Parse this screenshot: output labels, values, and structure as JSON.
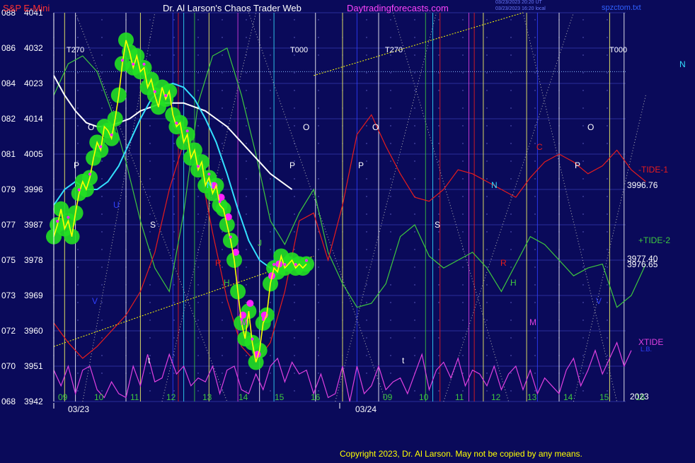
{
  "header": {
    "instrument": "S&P E-Mini",
    "site_title": "Dr. Al Larson's Chaos Trader Web",
    "site_url": "Daytradingforecasts.com",
    "timestamp_1": "03/23/2023 20:20 UT",
    "timestamp_2": "03/23/2023 16:20 local",
    "file_name": "spzctom.txt",
    "copyright": "Copyright 2023, Dr. Al Larson. May not be copied by any means."
  },
  "colors": {
    "background": "#0a0a5a",
    "grid": "#2b2f9a",
    "price_yellow": "#ffff00",
    "ema_white": "#ffffff",
    "ema_cyan": "#33e0ff",
    "tide_red": "#e81c1c",
    "tide_green": "#3ec83e",
    "xtide_magenta": "#e040e0",
    "bubble_green": "#22e022",
    "dot_magenta": "#ff22ff",
    "blue_line": "#3040ff"
  },
  "chart_data": {
    "type": "line",
    "y_axis_left_codes": [
      "088",
      "086",
      "084",
      "082",
      "081",
      "079",
      "077",
      "075",
      "073",
      "072",
      "070",
      "068"
    ],
    "y_axis_prices": [
      4041,
      4032,
      4023,
      4014,
      4005,
      3996,
      3987,
      3978,
      3969,
      3960,
      3951,
      3942
    ],
    "ylim": [
      3942,
      4041
    ],
    "x_hour_labels": [
      "09",
      "10",
      "11",
      "12",
      "13",
      "14",
      "15",
      "16",
      "09",
      "10",
      "11",
      "12",
      "13",
      "14",
      "15",
      "16"
    ],
    "x_date_labels": [
      "03/23",
      "03/24"
    ],
    "year_label": "2023",
    "series_labels": [
      "-TIDE-1",
      "+TIDE-2",
      "XTIDE",
      "L.B."
    ],
    "right_value_labels": [
      "3996.76",
      "3977.40",
      "3976.65"
    ],
    "marker_N": "N",
    "phase_labels": [
      "T270",
      "T000",
      "T270",
      "T000"
    ],
    "planet_letters": [
      "O",
      "P",
      "U",
      "V",
      "S",
      "N",
      "R",
      "H",
      "M",
      "J",
      "O",
      "P",
      "O",
      "P",
      "N",
      "S",
      "R",
      "H",
      "M",
      "O",
      "P",
      "C",
      "V",
      "t",
      "t"
    ],
    "price_series": {
      "name": "S&P E-Mini",
      "hours": [
        9.0,
        9.1,
        9.2,
        9.3,
        9.4,
        9.5,
        9.6,
        9.7,
        9.8,
        9.9,
        10.0,
        10.1,
        10.2,
        10.3,
        10.4,
        10.5,
        10.6,
        10.7,
        10.8,
        10.9,
        11.0,
        11.1,
        11.2,
        11.3,
        11.4,
        11.5,
        11.6,
        11.7,
        11.8,
        11.9,
        12.0,
        12.1,
        12.2,
        12.3,
        12.4,
        12.5,
        12.6,
        12.7,
        12.8,
        12.9,
        13.0,
        13.1,
        13.2,
        13.3,
        13.4,
        13.5,
        13.6,
        13.7,
        13.8,
        13.9,
        14.0,
        14.1,
        14.2,
        14.3,
        14.4,
        14.5,
        14.6,
        14.7,
        14.8,
        14.9,
        15.0,
        15.1,
        15.2,
        15.3,
        15.4,
        15.5,
        15.6,
        15.7,
        15.8,
        15.9,
        16.0
      ],
      "values": [
        3984,
        3987,
        3991,
        3986,
        3988,
        3984,
        3990,
        3995,
        3998,
        3996,
        3999,
        4004,
        4008,
        4006,
        4012,
        4011,
        4009,
        4014,
        4020,
        4028,
        4034,
        4031,
        4027,
        4030,
        4026,
        4027,
        4022,
        4024,
        4020,
        4017,
        4022,
        4019,
        4021,
        4015,
        4012,
        4013,
        4008,
        4010,
        4004,
        4006,
        4001,
        4003,
        3997,
        3999,
        3995,
        3997,
        3992,
        3991,
        3987,
        3983,
        3978,
        3970,
        3962,
        3958,
        3965,
        3957,
        3952,
        3955,
        3962,
        3964,
        3972,
        3976,
        3975,
        3979,
        3976,
        3977,
        3978,
        3976,
        3977,
        3976,
        3977
      ]
    },
    "ema_white": {
      "hours": [
        9.0,
        9.3,
        9.6,
        9.9,
        10.2,
        10.5,
        10.8,
        11.1,
        11.4,
        11.7,
        12.0,
        12.3,
        12.6,
        12.9,
        13.2,
        13.5,
        13.8,
        14.1,
        14.4,
        14.7,
        15.0,
        15.3,
        15.6
      ],
      "values": [
        4025,
        4020,
        4016,
        4013,
        4012,
        4012,
        4013,
        4014,
        4016,
        4017,
        4018,
        4018,
        4018,
        4017,
        4016,
        4014,
        4012,
        4009,
        4006,
        4003,
        4000,
        3998,
        3996
      ]
    },
    "ema_cyan": {
      "hours": [
        9.0,
        9.3,
        9.6,
        9.9,
        10.2,
        10.5,
        10.8,
        11.1,
        11.4,
        11.7,
        12.0,
        12.3,
        12.6,
        12.9,
        13.2,
        13.5,
        13.8,
        14.1,
        14.4,
        14.7,
        15.0,
        15.3,
        15.6,
        15.9
      ],
      "values": [
        3992,
        3996,
        3998,
        3996,
        3996,
        3998,
        4002,
        4008,
        4014,
        4019,
        4022,
        4023,
        4022,
        4019,
        4014,
        4008,
        4000,
        3991,
        3983,
        3978,
        3976,
        3975,
        3976,
        3977
      ]
    },
    "tide_red": {
      "hours": [
        9.0,
        9.4,
        9.8,
        10.2,
        10.6,
        11.0,
        11.4,
        11.8,
        12.2,
        12.6,
        13.0,
        13.4,
        13.8,
        14.2,
        14.6,
        15.0,
        15.4,
        15.8,
        16.2,
        16.6,
        17.0,
        17.4,
        17.8,
        18.2,
        18.6,
        19.0,
        19.4,
        19.8,
        20.2,
        20.6,
        21.0,
        21.4,
        21.8,
        22.2,
        22.6,
        23.0,
        23.4,
        23.8,
        24.2,
        24.6,
        25.0,
        25.4
      ],
      "values": [
        3962,
        3957,
        3953,
        3956,
        3960,
        3964,
        3970,
        3980,
        3996,
        4008,
        4004,
        3985,
        3968,
        3956,
        3952,
        3957,
        3970,
        3988,
        3990,
        3978,
        3992,
        4010,
        4015,
        4007,
        4000,
        3994,
        3993,
        3996,
        4001,
        4000,
        3998,
        3996,
        3994,
        3999,
        4003,
        4005,
        4003,
        4000,
        4002,
        4006,
        4001,
        3998
      ]
    },
    "tide_green": {
      "hours": [
        9.0,
        9.4,
        9.8,
        10.2,
        10.6,
        11.0,
        11.4,
        11.8,
        12.2,
        12.6,
        13.0,
        13.4,
        13.8,
        14.2,
        14.6,
        15.0,
        15.4,
        15.8,
        16.2,
        16.6,
        17.0,
        17.4,
        17.8,
        18.2,
        18.6,
        19.0,
        19.4,
        19.8,
        20.2,
        20.6,
        21.0,
        21.4,
        21.8,
        22.2,
        22.6,
        23.0,
        23.4,
        23.8,
        24.2,
        24.6,
        25.0,
        25.4
      ],
      "values": [
        4020,
        4028,
        4030,
        4026,
        4016,
        4003,
        3988,
        3976,
        3970,
        3990,
        4018,
        4030,
        4032,
        4020,
        4005,
        3988,
        3982,
        3990,
        3996,
        3980,
        3972,
        3966,
        3967,
        3972,
        3984,
        3987,
        3979,
        3976,
        3978,
        3980,
        3976,
        3970,
        3977,
        3984,
        3982,
        3978,
        3974,
        3976,
        3977,
        3966,
        3969,
        3977
      ]
    },
    "xtide": {
      "hours": [
        9.0,
        9.2,
        9.4,
        9.6,
        9.8,
        10.0,
        10.2,
        10.4,
        10.6,
        10.8,
        11.0,
        11.2,
        11.4,
        11.6,
        11.8,
        12.0,
        12.2,
        12.4,
        12.6,
        12.8,
        13.0,
        13.2,
        13.4,
        13.6,
        13.8,
        14.0,
        14.2,
        14.4,
        14.6,
        14.8,
        15.0,
        15.2,
        15.4,
        15.6,
        15.8,
        16.0,
        16.2,
        16.4,
        16.6,
        16.8,
        17.0,
        17.2,
        17.4,
        17.6,
        17.8,
        18.0,
        18.2,
        18.4,
        18.6,
        18.8,
        19.0,
        19.2,
        19.4,
        19.6,
        19.8,
        20.0,
        20.2,
        20.4,
        20.6,
        20.8,
        21.0,
        21.2,
        21.4,
        21.6,
        21.8,
        22.0,
        22.2,
        22.4,
        22.6,
        22.8,
        23.0,
        23.2,
        23.4,
        23.6,
        23.8,
        24.0,
        24.2,
        24.4,
        24.6,
        24.8,
        25.0
      ],
      "values": [
        3950,
        3946,
        3951,
        3944,
        3950,
        3951,
        3945,
        3943,
        3947,
        3944,
        3943,
        3951,
        3946,
        3954,
        3947,
        3948,
        3954,
        3949,
        3951,
        3946,
        3948,
        3947,
        3951,
        3944,
        3950,
        3951,
        3945,
        3944,
        3949,
        3945,
        3951,
        3953,
        3947,
        3952,
        3949,
        3950,
        3944,
        3949,
        3943,
        3944,
        3951,
        3942,
        3951,
        3944,
        3946,
        3951,
        3945,
        3947,
        3948,
        3944,
        3949,
        3954,
        3945,
        3950,
        3952,
        3948,
        3953,
        3946,
        3950,
        3949,
        3946,
        3951,
        3945,
        3949,
        3951,
        3945,
        3950,
        3944,
        3948,
        3946,
        3944,
        3950,
        3953,
        3946,
        3950,
        3955,
        3949,
        3953,
        3957,
        3951,
        3955
      ]
    },
    "trend_line_lower": {
      "hours": [
        9.0,
        16.2
      ],
      "values": [
        3956,
        3979
      ]
    },
    "trend_line_upper": {
      "hours": [
        16.2,
        22.0
      ],
      "values": [
        4025,
        4041
      ]
    },
    "h_line_cyan": 4026
  }
}
